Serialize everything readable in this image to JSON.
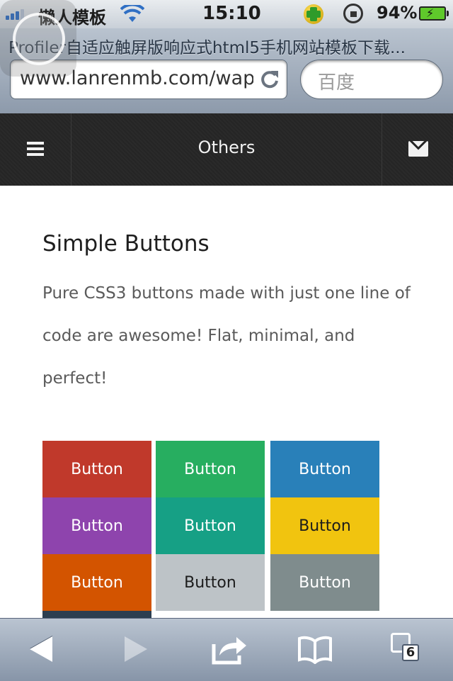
{
  "status_bar": {
    "carrier": "懒人模板",
    "time": "15:10",
    "battery_percent": "94%",
    "battery_level": 0.94,
    "icons": [
      "signal-icon",
      "wifi-icon",
      "qq-icon",
      "rotation-lock-icon",
      "battery-charging-icon"
    ]
  },
  "browser": {
    "page_title": "Profiler自适应触屏版响应式html5手机网站模板下载...",
    "url": "www.lanrenmb.com/wap",
    "search_placeholder": "百度",
    "tab_count": "6",
    "icons": [
      "reload-icon",
      "back-icon",
      "forward-icon",
      "share-icon",
      "bookmarks-icon",
      "tabs-icon"
    ]
  },
  "site_header": {
    "title": "Others",
    "icons": [
      "menu-icon",
      "mail-icon"
    ]
  },
  "main": {
    "heading": "Simple Buttons",
    "description": "Pure CSS3 buttons made with just one line of code are awesome! Flat, minimal, and perfect!",
    "buttons": [
      {
        "label": "Button",
        "color": "#c0392b",
        "text_color": "#ffffff"
      },
      {
        "label": "Button",
        "color": "#27ae60",
        "text_color": "#ffffff"
      },
      {
        "label": "Button",
        "color": "#2980b9",
        "text_color": "#ffffff"
      },
      {
        "label": "Button",
        "color": "#8e44ad",
        "text_color": "#ffffff"
      },
      {
        "label": "Button",
        "color": "#16a085",
        "text_color": "#ffffff"
      },
      {
        "label": "Button",
        "color": "#f1c40f",
        "text_color": "#1c1c1c"
      },
      {
        "label": "Button",
        "color": "#d35400",
        "text_color": "#ffffff"
      },
      {
        "label": "Button",
        "color": "#bdc3c7",
        "text_color": "#1c1c1c"
      },
      {
        "label": "Button",
        "color": "#7f8c8d",
        "text_color": "#ffffff"
      }
    ],
    "partial_button_color": "#2c3e50"
  }
}
